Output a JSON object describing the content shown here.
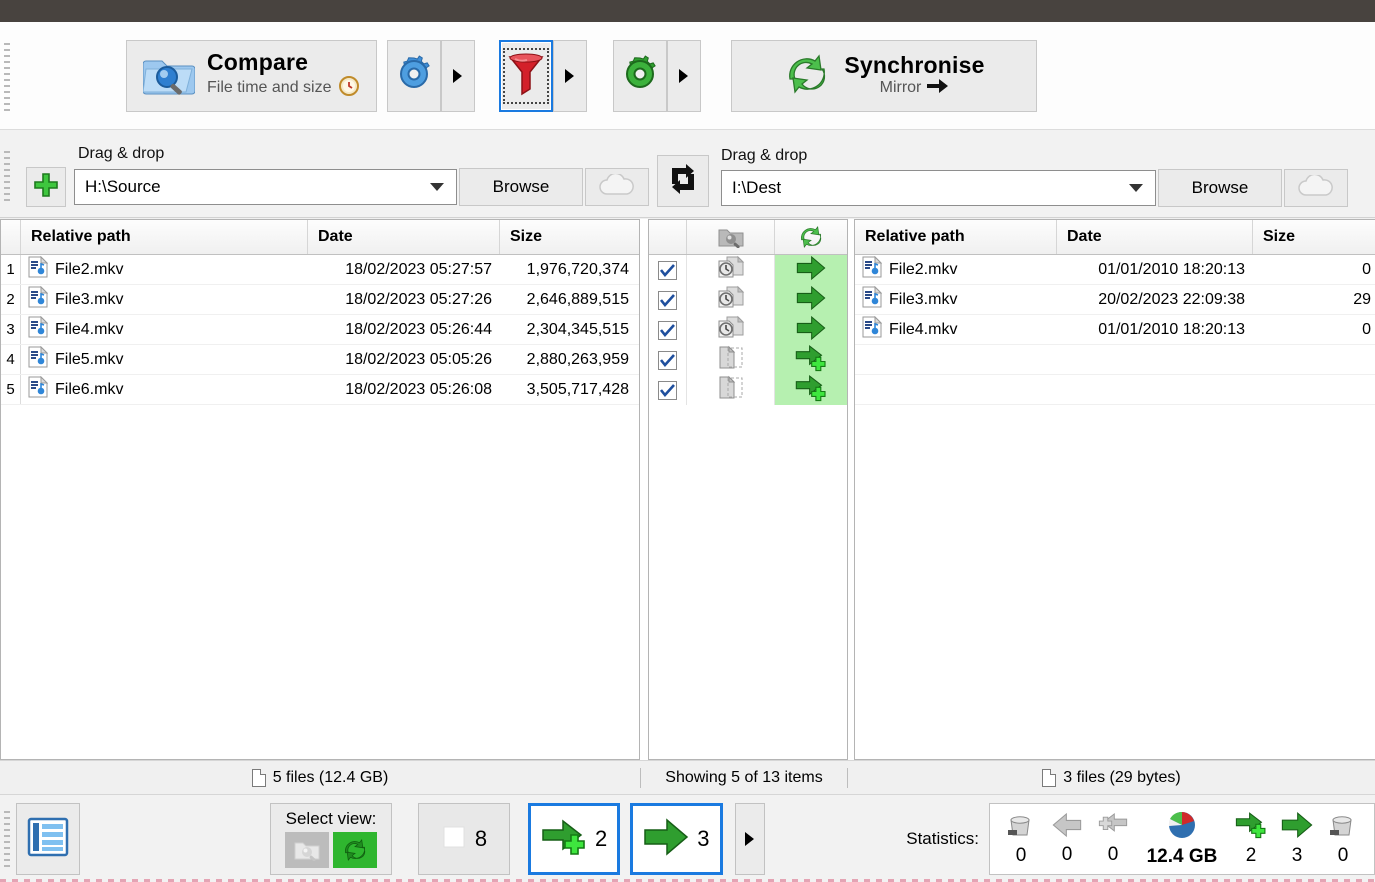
{
  "toolbar": {
    "compare": {
      "title": "Compare",
      "subtitle": "File time and size",
      "icon": "folder-search-icon",
      "sub_icon": "clock-icon"
    },
    "compare_settings": {
      "icon": "blue-gear-icon"
    },
    "compare_dropdown": {
      "icon": "caret-right-icon"
    },
    "filter": {
      "icon": "red-funnel-icon",
      "selected": true
    },
    "filter_dropdown": {
      "icon": "caret-right-icon"
    },
    "sync_settings": {
      "icon": "green-gear-icon"
    },
    "sync_dropdown": {
      "icon": "caret-right-icon"
    },
    "synchronise": {
      "title": "Synchronise",
      "subtitle": "Mirror",
      "icon": "green-sync-icon",
      "sub_icon": "black-arrow-right-icon"
    }
  },
  "dirpair": {
    "left": {
      "drag_drop_label": "Drag & drop",
      "path": "H:\\Source",
      "placeholder": "Drag & drop",
      "browse_label": "Browse",
      "add_icon": "green-plus-icon",
      "cloud_icon": "cloud-icon"
    },
    "right": {
      "drag_drop_label": "Drag & drop",
      "path": "I:\\Dest",
      "placeholder": "Drag & drop",
      "browse_label": "Browse",
      "cloud_icon": "cloud-icon"
    },
    "swap_icon": "swap-sides-icon"
  },
  "grid": {
    "left_headers": {
      "path": "Relative path",
      "date": "Date",
      "size": "Size"
    },
    "right_headers": {
      "path": "Relative path",
      "date": "Date",
      "size": "Size"
    },
    "middle_headers": {
      "checkbox": "",
      "category": "category-icon",
      "action": "sync-action-icon"
    },
    "left_rows": [
      {
        "num": "1",
        "name": "File2.mkv",
        "date": "18/02/2023  05:27:57",
        "size": "1,976,720,374",
        "icon": "media-file-icon"
      },
      {
        "num": "2",
        "name": "File3.mkv",
        "date": "18/02/2023  05:27:26",
        "size": "2,646,889,515",
        "icon": "media-file-icon"
      },
      {
        "num": "3",
        "name": "File4.mkv",
        "date": "18/02/2023  05:26:44",
        "size": "2,304,345,515",
        "icon": "media-file-icon"
      },
      {
        "num": "4",
        "name": "File5.mkv",
        "date": "18/02/2023  05:05:26",
        "size": "2,880,263,959",
        "icon": "media-file-icon"
      },
      {
        "num": "5",
        "name": "File6.mkv",
        "date": "18/02/2023  05:26:08",
        "size": "3,505,717,428",
        "icon": "media-file-icon"
      }
    ],
    "middle_rows": [
      {
        "checked": true,
        "category": "left-newer-icon",
        "action": "arrow-right-icon"
      },
      {
        "checked": true,
        "category": "left-newer-icon",
        "action": "arrow-right-icon"
      },
      {
        "checked": true,
        "category": "left-newer-icon",
        "action": "arrow-right-icon"
      },
      {
        "checked": true,
        "category": "left-only-icon",
        "action": "arrow-right-plus-icon"
      },
      {
        "checked": true,
        "category": "left-only-icon",
        "action": "arrow-right-plus-icon"
      }
    ],
    "right_rows": [
      {
        "name": "File2.mkv",
        "date": "01/01/2010  18:20:13",
        "size": "0",
        "icon": "media-file-icon"
      },
      {
        "name": "File3.mkv",
        "date": "20/02/2023  22:09:38",
        "size": "29",
        "icon": "media-file-icon"
      },
      {
        "name": "File4.mkv",
        "date": "01/01/2010  18:20:13",
        "size": "0",
        "icon": "media-file-icon"
      },
      {
        "name": "",
        "date": "",
        "size": "",
        "icon": ""
      },
      {
        "name": "",
        "date": "",
        "size": "",
        "icon": ""
      }
    ]
  },
  "status": {
    "left": "5 files (12.4 GB)",
    "center": "Showing 5 of 13 items",
    "right": "3 files (29 bytes)",
    "file_icon": "document-icon"
  },
  "bottom": {
    "overview_icon": "overview-list-icon",
    "select_view_label": "Select view:",
    "view_compare_icon": "folder-search-icon",
    "view_sync_icon": "green-sync-icon",
    "equal_button": {
      "count": "8",
      "icon": "white-square-icon"
    },
    "create_button": {
      "count": "2",
      "icon": "arrow-right-plus-icon",
      "active": true
    },
    "update_button": {
      "count": "3",
      "icon": "arrow-right-icon",
      "active": true
    },
    "more_button": {
      "icon": "caret-right-icon"
    },
    "statistics_label": "Statistics:",
    "statistics": [
      {
        "icon": "delete-left-icon",
        "value": "0"
      },
      {
        "icon": "arrow-left-grey-icon",
        "value": "0"
      },
      {
        "icon": "plus-left-grey-icon",
        "value": "0"
      },
      {
        "icon": "pie-chart-icon",
        "value": "12.4 GB",
        "bold": true
      },
      {
        "icon": "arrow-right-plus-icon",
        "value": "2"
      },
      {
        "icon": "arrow-right-icon",
        "value": "3"
      },
      {
        "icon": "delete-right-icon",
        "value": "0"
      }
    ]
  },
  "colors": {
    "accent_blue": "#1a7ae0",
    "green_highlight": "#b6f0b0",
    "sync_green": "#2fb62f",
    "toolbar_bg": "#ebebeb"
  }
}
